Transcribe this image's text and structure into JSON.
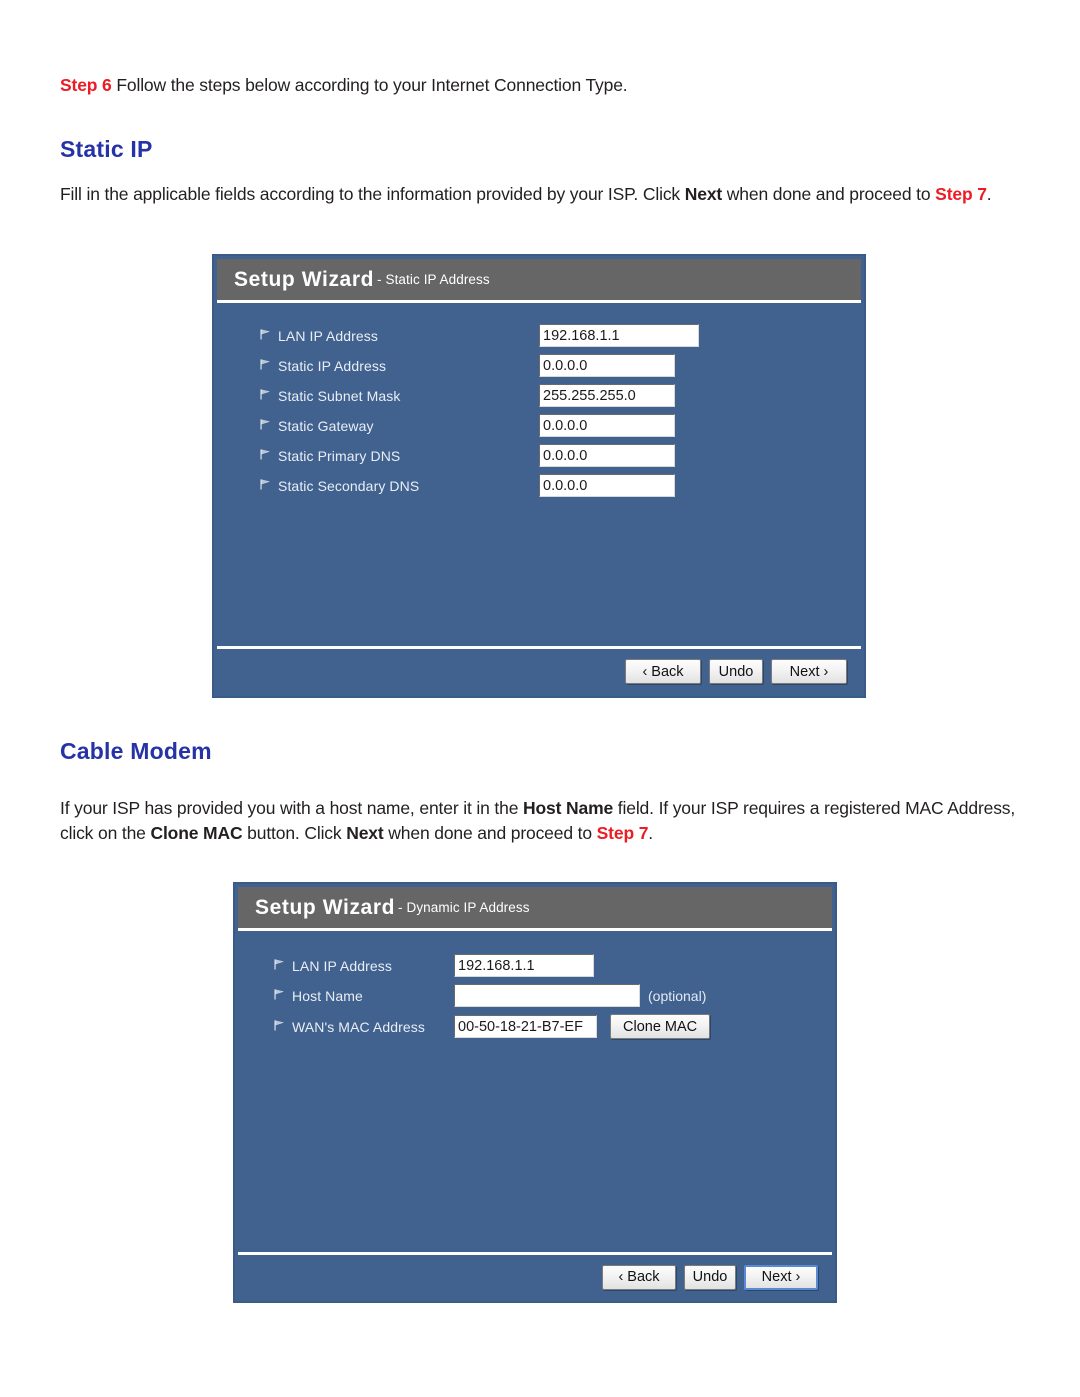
{
  "document": {
    "step6_line": {
      "step_label": "Step 6",
      "text": " Follow the steps below according to your Internet Connection Type."
    },
    "sections": [
      {
        "heading": "Static IP",
        "paragraph_parts": [
          {
            "text": "Fill in the applicable fields according to the information provided by your ISP. Click ",
            "style": "normal"
          },
          {
            "text": "Next",
            "style": "bold"
          },
          {
            "text": " when done and proceed to ",
            "style": "normal"
          },
          {
            "text": "Step 7",
            "style": "red"
          },
          {
            "text": ".",
            "style": "normal"
          }
        ]
      },
      {
        "heading": "Cable  Modem",
        "paragraph_parts": [
          {
            "text": "If your ISP has provided you with a host name, enter it in the ",
            "style": "normal"
          },
          {
            "text": "Host Name",
            "style": "bold"
          },
          {
            "text": " field. If your ISP requires a registered MAC Address, click on the ",
            "style": "normal"
          },
          {
            "text": "Clone MAC",
            "style": "bold"
          },
          {
            "text": " button. Click ",
            "style": "normal"
          },
          {
            "text": "Next",
            "style": "bold"
          },
          {
            "text": " when done and proceed to ",
            "style": "normal"
          },
          {
            "text": "Step 7",
            "style": "red"
          },
          {
            "text": ".",
            "style": "normal"
          }
        ]
      }
    ]
  },
  "static_ip_panel": {
    "header": {
      "title": "Setup Wizard",
      "subtitle": "- Static IP Address"
    },
    "fields": [
      {
        "label": "LAN IP Address",
        "value": "192.168.1.1",
        "input_width": 160
      },
      {
        "label": "Static IP Address",
        "value": "0.0.0.0",
        "input_width": 136
      },
      {
        "label": "Static Subnet Mask",
        "value": "255.255.255.0",
        "input_width": 136
      },
      {
        "label": "Static Gateway",
        "value": "0.0.0.0",
        "input_width": 136
      },
      {
        "label": "Static Primary DNS",
        "value": "0.0.0.0",
        "input_width": 136
      },
      {
        "label": "Static Secondary DNS",
        "value": "0.0.0.0",
        "input_width": 136
      }
    ],
    "buttons": {
      "back": "‹ Back",
      "undo": "Undo",
      "next": "Next ›"
    }
  },
  "dynamic_ip_panel": {
    "header": {
      "title": "Setup Wizard",
      "subtitle": "- Dynamic IP Address"
    },
    "fields": [
      {
        "label": "LAN IP Address",
        "value": "192.168.1.1",
        "placeholder": "",
        "input_width": 140,
        "note": ""
      },
      {
        "label": "Host Name",
        "value": "",
        "placeholder": "",
        "input_width": 186,
        "note": "(optional)"
      },
      {
        "label": "WAN's MAC Address",
        "value": "00-50-18-21-B7-EF",
        "placeholder": "",
        "input_width": 143,
        "note": ""
      }
    ],
    "clone_mac_label": "Clone MAC",
    "buttons": {
      "back": "‹ Back",
      "undo": "Undo",
      "next": "Next ›"
    }
  },
  "colors": {
    "panel_blue": "#41628F",
    "panel_header_gray": "#666666",
    "heading_blue": "#2533A6",
    "accent_red": "#ED1C24",
    "input_white": "#FFFFFF"
  }
}
